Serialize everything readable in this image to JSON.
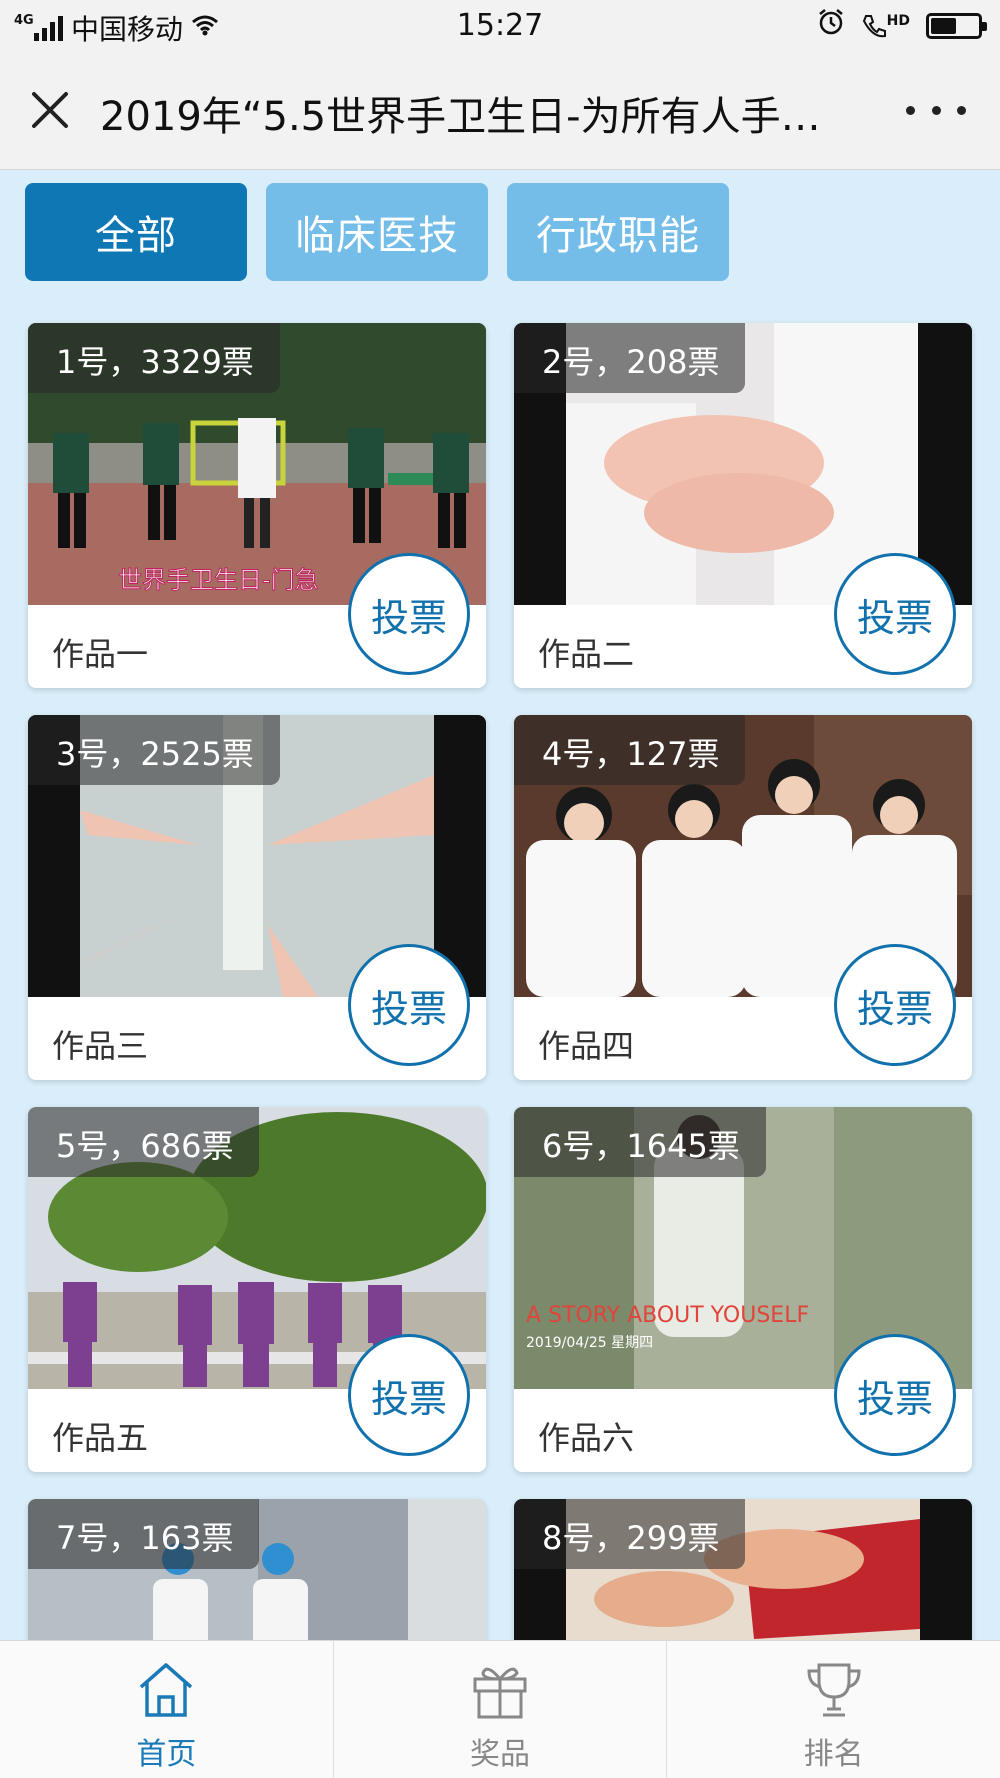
{
  "status_bar": {
    "network": "4G",
    "carrier": "中国移动",
    "time": "15:27",
    "hd": "HD",
    "battery_level": 0.55
  },
  "title_bar": {
    "title": "2019年“5.5世界手卫生日-为所有人手…"
  },
  "filters": [
    {
      "label": "全部",
      "active": true
    },
    {
      "label": "临床医技",
      "active": false
    },
    {
      "label": "行政职能",
      "active": false
    }
  ],
  "vote_button_label": "投票",
  "entries": [
    {
      "badge": "1号，3329票",
      "name": "作品一",
      "thumb_text": "世界手卫生日-门急"
    },
    {
      "badge": "2号，208票",
      "name": "作品二"
    },
    {
      "badge": "3号，2525票",
      "name": "作品三"
    },
    {
      "badge": "4号，127票",
      "name": "作品四"
    },
    {
      "badge": "5号，686票",
      "name": "作品五"
    },
    {
      "badge": "6号，1645票",
      "name": "作品六",
      "thumb_text": "A STORY ABOUT YOUSELF",
      "thumb_subtext": "2019/04/25 星期四"
    },
    {
      "badge": "7号，163票"
    },
    {
      "badge": "8号，299票"
    }
  ],
  "bottom_nav": [
    {
      "label": "首页",
      "icon": "home-icon",
      "active": true
    },
    {
      "label": "奖品",
      "icon": "gift-icon",
      "active": false
    },
    {
      "label": "排名",
      "icon": "trophy-icon",
      "active": false
    }
  ],
  "colors": {
    "accent": "#0f78b4",
    "tab_inactive": "#74bde9",
    "page_bg": "#d9eefa",
    "vote_button": "#1171ad"
  }
}
